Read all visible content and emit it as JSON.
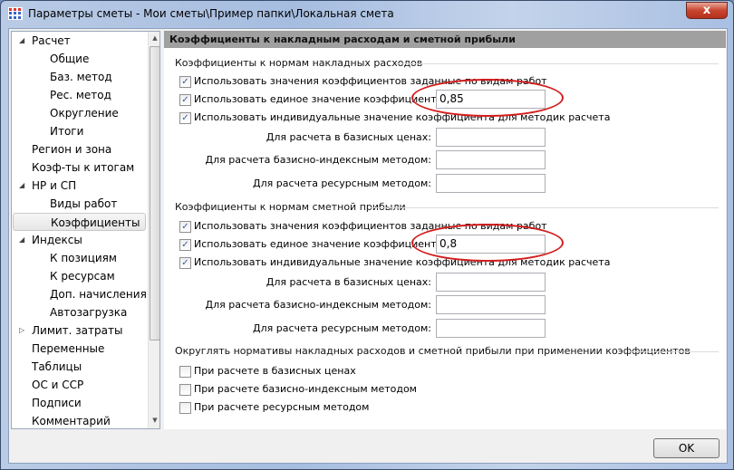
{
  "window": {
    "title": "Параметры сметы - Мои сметы\\Пример папки\\Локальная смета",
    "close_label": "x"
  },
  "tree": [
    {
      "label": "Расчет",
      "level": 0,
      "expander": "expanded"
    },
    {
      "label": "Общие",
      "level": 1
    },
    {
      "label": "Баз. метод",
      "level": 1
    },
    {
      "label": "Рес. метод",
      "level": 1
    },
    {
      "label": "Округление",
      "level": 1
    },
    {
      "label": "Итоги",
      "level": 1
    },
    {
      "label": "Регион и зона",
      "level": 0
    },
    {
      "label": "Коэф-ты к итогам",
      "level": 0
    },
    {
      "label": "НР и СП",
      "level": 0,
      "expander": "expanded"
    },
    {
      "label": "Виды работ",
      "level": 1
    },
    {
      "label": "Коэффициенты",
      "level": 1,
      "selected": true
    },
    {
      "label": "Индексы",
      "level": 0,
      "expander": "expanded"
    },
    {
      "label": "К позициям",
      "level": 1
    },
    {
      "label": "К ресурсам",
      "level": 1
    },
    {
      "label": "Доп. начисления",
      "level": 1
    },
    {
      "label": "Автозагрузка",
      "level": 1
    },
    {
      "label": "Лимит. затраты",
      "level": 0,
      "expander": "collapsed"
    },
    {
      "label": "Переменные",
      "level": 0
    },
    {
      "label": "Таблицы",
      "level": 0
    },
    {
      "label": "ОС и ССР",
      "level": 0
    },
    {
      "label": "Подписи",
      "level": 0
    },
    {
      "label": "Комментарий",
      "level": 0
    }
  ],
  "panel": {
    "header": "Коэффициенты к накладным расходам и сметной прибыли",
    "overhead": {
      "title": "Коэффициенты к нормам накладных расходов",
      "cb1": "Использовать значения коэффициентов заданные по видам работ",
      "cb2": "Использовать единое значение коэффициента:",
      "cb2_value": "0,85",
      "cb3": "Использовать индивидуальные значение коэффициента для методик расчета",
      "f1": "Для расчета в базисных ценах:",
      "f1_value": "",
      "f2": "Для расчета базисно-индексным методом:",
      "f2_value": "",
      "f3": "Для расчета ресурсным методом:",
      "f3_value": ""
    },
    "profit": {
      "title": "Коэффициенты к нормам сметной прибыли",
      "cb1": "Использовать значения коэффициентов заданные по видам работ",
      "cb2": "Использовать единое значение коэффициента:",
      "cb2_value": "0,8",
      "cb3": "Использовать индивидуальные значение коэффициента для методик расчета",
      "f1": "Для расчета в базисных ценах:",
      "f1_value": "",
      "f2": "Для расчета базисно-индексным методом:",
      "f2_value": "",
      "f3": "Для расчета ресурсным методом:",
      "f3_value": ""
    },
    "rounding": {
      "title": "Округлять нормативы накладных расходов и сметной прибыли при применении коэффициентов",
      "cb1": "При расчете в базисных ценах",
      "cb2": "При расчете базисно-индексным методом",
      "cb3": "При расчете ресурсным методом"
    }
  },
  "footer": {
    "ok_label": "OK"
  },
  "colors": {
    "highlight_ellipse": "#d41c1c",
    "header_band": "#a0a0a0"
  }
}
